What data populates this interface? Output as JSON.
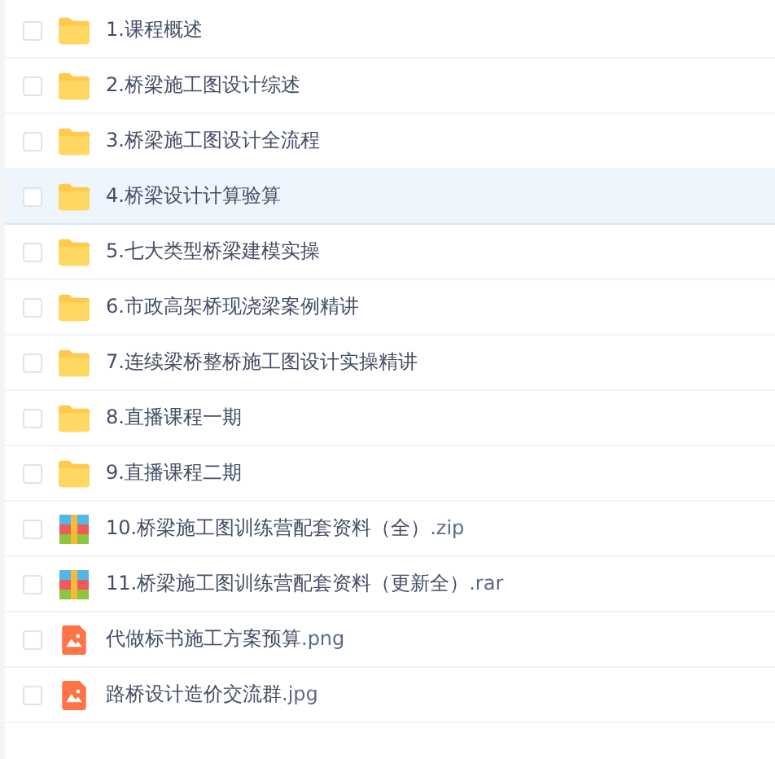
{
  "files": [
    {
      "kind": "folder",
      "name": "1.课程概述",
      "selected": false
    },
    {
      "kind": "folder",
      "name": "2.桥梁施工图设计综述",
      "selected": false
    },
    {
      "kind": "folder",
      "name": "3.桥梁施工图设计全流程",
      "selected": false
    },
    {
      "kind": "folder",
      "name": "4.桥梁设计计算验算",
      "selected": true
    },
    {
      "kind": "folder",
      "name": "5.七大类型桥梁建模实操",
      "selected": false
    },
    {
      "kind": "folder",
      "name": "6.市政高架桥现浇梁案例精讲",
      "selected": false
    },
    {
      "kind": "folder",
      "name": "7.连续梁桥整桥施工图设计实操精讲",
      "selected": false
    },
    {
      "kind": "folder",
      "name": "8.直播课程一期",
      "selected": false
    },
    {
      "kind": "folder",
      "name": "9.直播课程二期",
      "selected": false
    },
    {
      "kind": "archive",
      "name": "10.桥梁施工图训练营配套资料（全）",
      "ext": ".zip",
      "selected": false
    },
    {
      "kind": "archive",
      "name": "11.桥梁施工图训练营配套资料（更新全）",
      "ext": ".rar",
      "selected": false
    },
    {
      "kind": "image",
      "name": "代做标书施工方案预算",
      "ext": ".png",
      "selected": false
    },
    {
      "kind": "image",
      "name": "路桥设计造价交流群",
      "ext": ".jpg",
      "selected": false
    }
  ]
}
